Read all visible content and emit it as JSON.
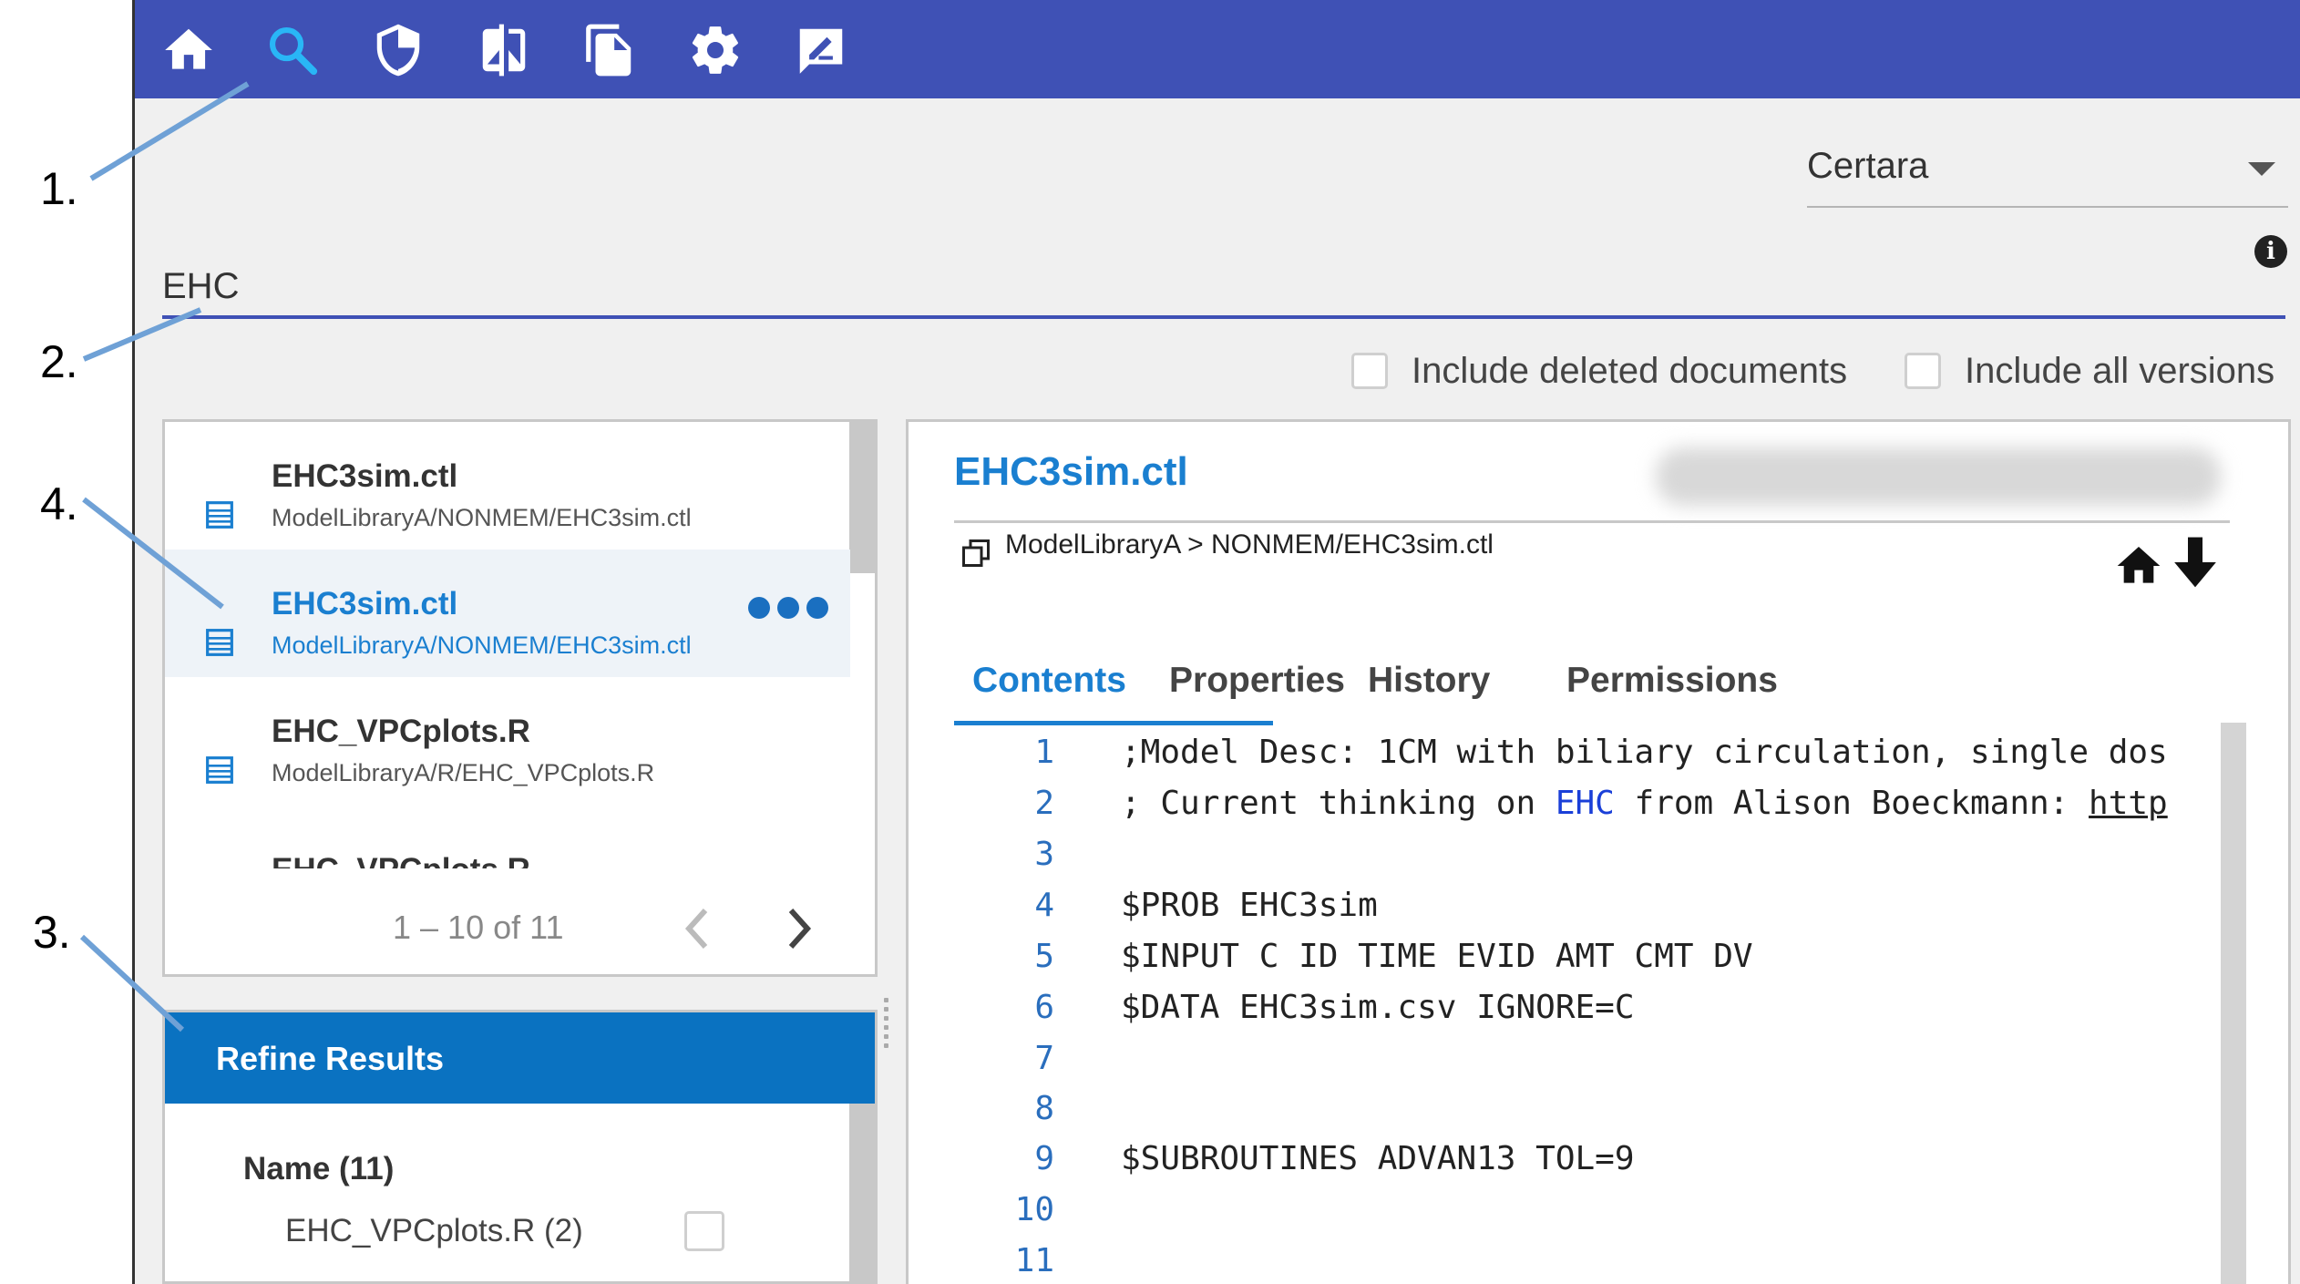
{
  "callouts": [
    "1.",
    "2.",
    "4.",
    "3."
  ],
  "toolbar": {
    "bg_color": "#3f51b5",
    "icons": [
      "home-icon",
      "search-icon",
      "shield-icon",
      "compare-icon",
      "copy-documents-icon",
      "settings-icon",
      "signature-icon"
    ],
    "active_icon_color": "#29b6f6"
  },
  "org_select": {
    "value": "Certara"
  },
  "search": {
    "value": "EHC"
  },
  "options": {
    "include_deleted": "Include deleted documents",
    "include_all_versions": "Include all versions"
  },
  "results": {
    "items": [
      {
        "title": "EHC3sim.ctl",
        "path": "ModelLibraryA/NONMEM/EHC3sim.ctl",
        "selected": false
      },
      {
        "title": "EHC3sim.ctl",
        "path": "ModelLibraryA/NONMEM/EHC3sim.ctl",
        "selected": true
      },
      {
        "title": "EHC_VPCplots.R",
        "path": "ModelLibraryA/R/EHC_VPCplots.R",
        "selected": false
      }
    ],
    "partial_item": "EHC_VPCplots.R",
    "pager": {
      "label": "1 – 10 of 11"
    }
  },
  "refine": {
    "header": "Refine Results",
    "facet_heading": "Name (11)",
    "facet_items": [
      "EHC_VPCplots.R (2)"
    ]
  },
  "document": {
    "title": "EHC3sim.ctl",
    "breadcrumb": "ModelLibraryA > NONMEM/EHC3sim.ctl",
    "tabs": [
      "Contents",
      "Properties",
      "History",
      "Permissions"
    ],
    "active_tab": "Contents",
    "lines": [
      {
        "num": "1",
        "text": ";Model Desc: 1CM with biliary circulation, single dos"
      },
      {
        "num": "2",
        "pre": "; Current thinking on ",
        "hl": "EHC",
        "mid": " from Alison Boeckmann: ",
        "link": "http"
      },
      {
        "num": "3",
        "text": ""
      },
      {
        "num": "4",
        "text": "$PROB EHC3sim"
      },
      {
        "num": "5",
        "text": "$INPUT C ID TIME EVID AMT CMT DV"
      },
      {
        "num": "6",
        "text": "$DATA EHC3sim.csv IGNORE=C"
      },
      {
        "num": "7",
        "text": ""
      },
      {
        "num": "8",
        "text": ""
      },
      {
        "num": "9",
        "text": "$SUBROUTINES ADVAN13 TOL=9"
      },
      {
        "num": "10",
        "text": ""
      },
      {
        "num": "11",
        "text": ""
      }
    ]
  }
}
